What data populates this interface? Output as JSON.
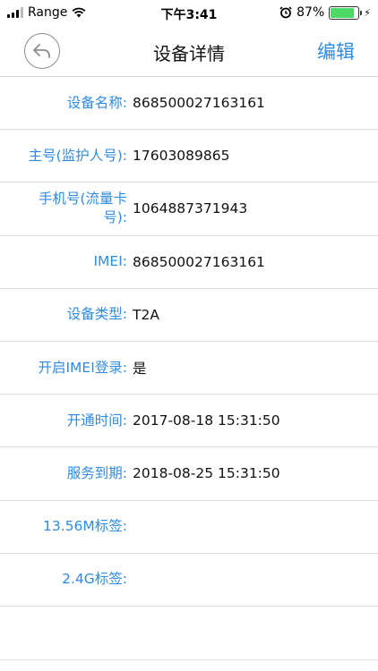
{
  "status_bar": {
    "carrier": "Range",
    "time": "下午3:41",
    "battery": "87%",
    "battery_level": 0.87
  },
  "nav": {
    "title": "设备详情",
    "edit_label": "编辑"
  },
  "rows": [
    {
      "label": "设备名称:",
      "value": "868500027163161"
    },
    {
      "label": "主号(监护人号):",
      "value": "17603089865"
    },
    {
      "label": "手机号(流量卡号):",
      "value": "1064887371943"
    },
    {
      "label": "IMEI:",
      "value": "868500027163161"
    },
    {
      "label": "设备类型:",
      "value": "T2A"
    },
    {
      "label": "开启IMEI登录:",
      "value": "是"
    },
    {
      "label": "开通时间:",
      "value": "2017-08-18 15:31:50"
    },
    {
      "label": "服务到期:",
      "value": "2018-08-25 15:31:50"
    },
    {
      "label": "13.56M标签:",
      "value": ""
    },
    {
      "label": "2.4G标签:",
      "value": ""
    }
  ]
}
